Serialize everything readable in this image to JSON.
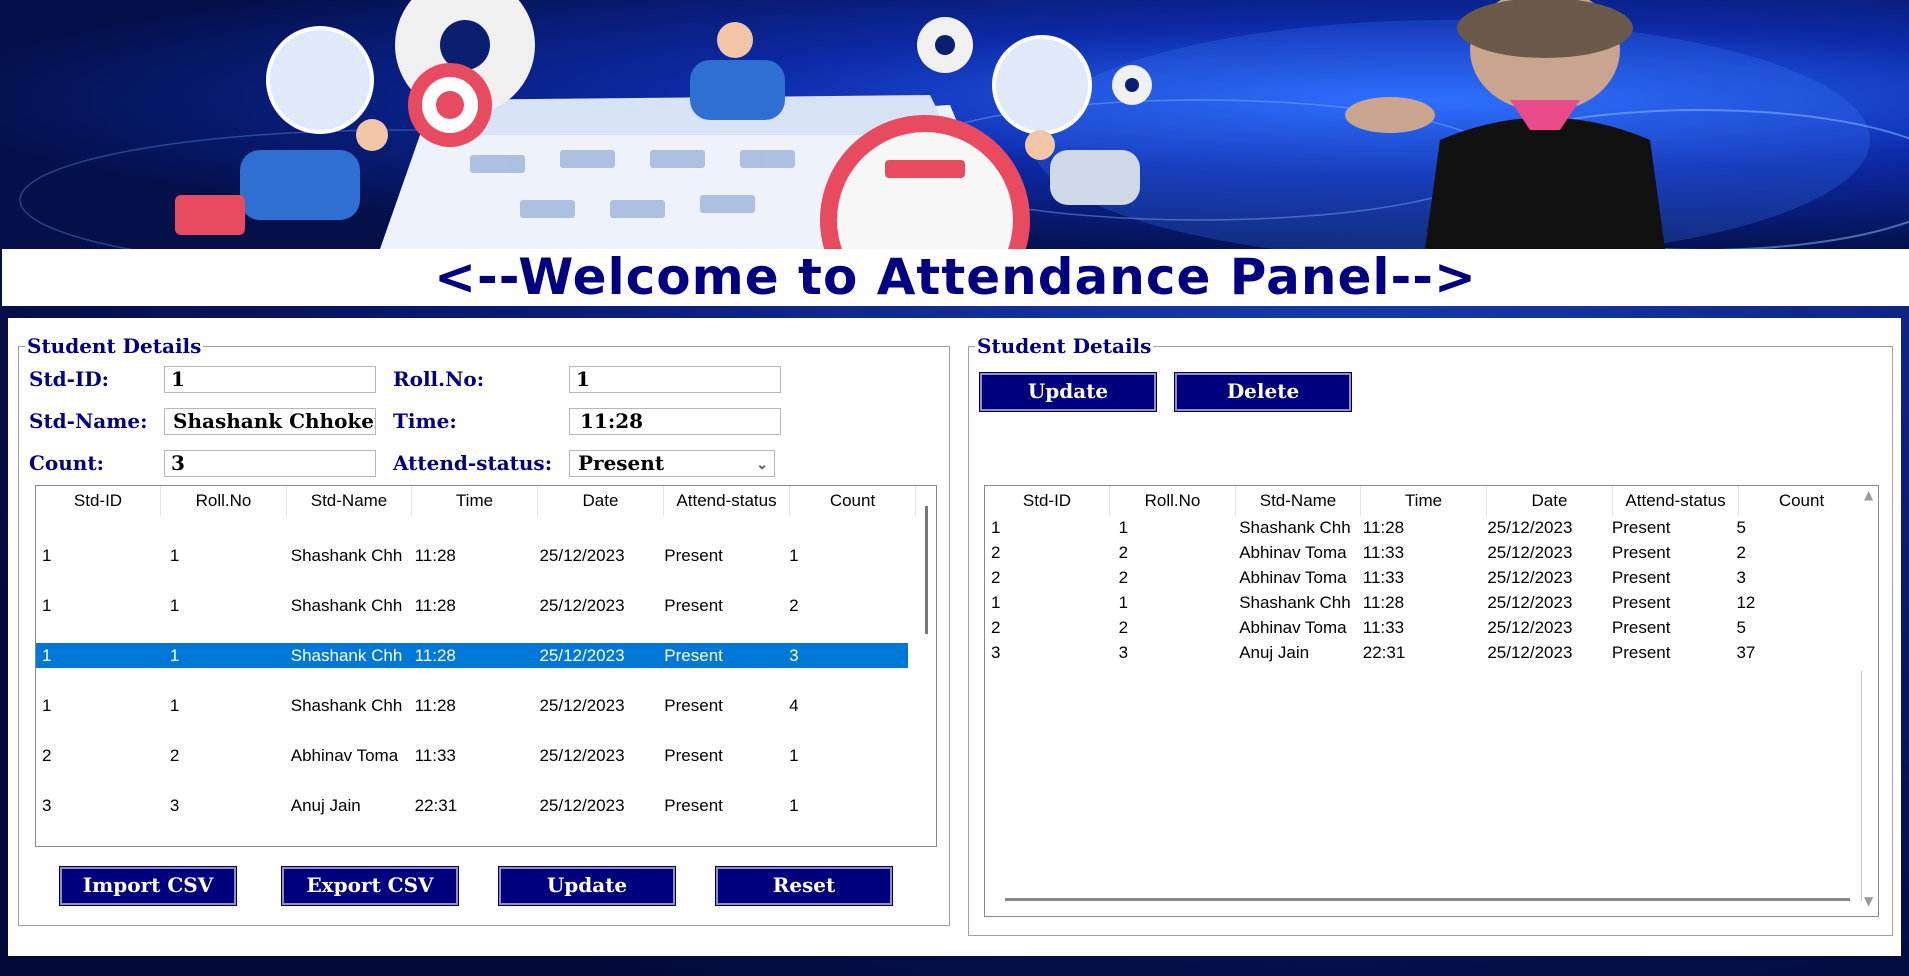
{
  "title": "<--Welcome to Attendance Panel-->",
  "form": {
    "group_title": "Student Details",
    "std_id_label": "Std-ID:",
    "std_id_value": "1",
    "roll_label": "Roll.No:",
    "roll_value": "1",
    "name_label": "Std-Name:",
    "name_value": "Shashank Chhoker",
    "time_label": "Time:",
    "time_value": "11:28",
    "count_label": "Count:",
    "count_value": "3",
    "status_label": "Attend-status:",
    "status_value": "Present"
  },
  "columns": [
    "Std-ID",
    "Roll.No",
    "Std-Name",
    "Time",
    "Date",
    "Attend-status",
    "Count"
  ],
  "left_table": {
    "selected_index": 2,
    "rows": [
      [
        "1",
        "1",
        "Shashank Chh",
        "11:28",
        "25/12/2023",
        "Present",
        "1"
      ],
      [
        "1",
        "1",
        "Shashank Chh",
        "11:28",
        "25/12/2023",
        "Present",
        "2"
      ],
      [
        "1",
        "1",
        "Shashank Chh",
        "11:28",
        "25/12/2023",
        "Present",
        "3"
      ],
      [
        "1",
        "1",
        "Shashank Chh",
        "11:28",
        "25/12/2023",
        "Present",
        "4"
      ],
      [
        "2",
        "2",
        "Abhinav Toma",
        "11:33",
        "25/12/2023",
        "Present",
        "1"
      ],
      [
        "3",
        "3",
        "Anuj Jain",
        "22:31",
        "25/12/2023",
        "Present",
        "1"
      ]
    ]
  },
  "left_buttons": {
    "import": "Import CSV",
    "export": "Export CSV",
    "update": "Update",
    "reset": "Reset"
  },
  "right_panel": {
    "group_title": "Student Details",
    "update": "Update",
    "delete": "Delete",
    "rows": [
      [
        "1",
        "1",
        "Shashank Chh",
        "11:28",
        "25/12/2023",
        "Present",
        "5"
      ],
      [
        "2",
        "2",
        "Abhinav Toma",
        "11:33",
        "25/12/2023",
        "Present",
        "2"
      ],
      [
        "2",
        "2",
        "Abhinav Toma",
        "11:33",
        "25/12/2023",
        "Present",
        "3"
      ],
      [
        "1",
        "1",
        "Shashank Chh",
        "11:28",
        "25/12/2023",
        "Present",
        "12"
      ],
      [
        "2",
        "2",
        "Abhinav Toma",
        "11:33",
        "25/12/2023",
        "Present",
        "5"
      ],
      [
        "3",
        "3",
        "Anuj Jain",
        "22:31",
        "25/12/2023",
        "Present",
        "37"
      ]
    ]
  },
  "colors": {
    "title_text": "#000080",
    "button_bg": "#00007f",
    "selection": "#0078d7"
  }
}
